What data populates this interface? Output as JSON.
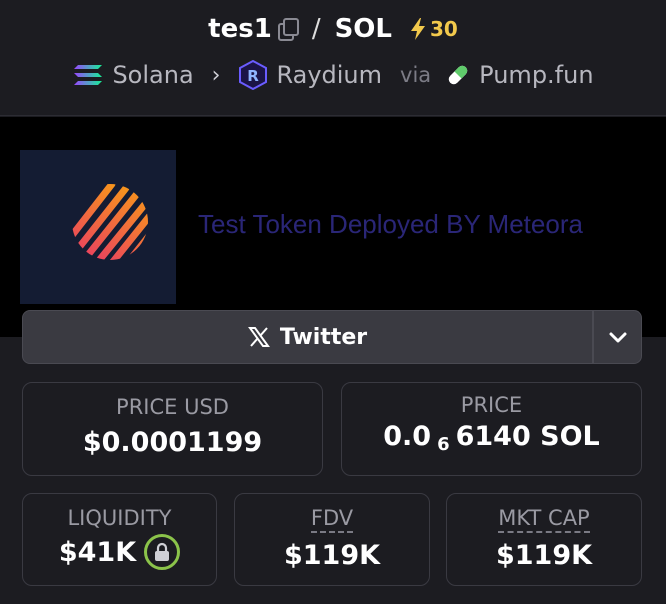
{
  "header": {
    "token_symbol": "tes1",
    "separator": "/",
    "quote_symbol": "SOL",
    "boost_count": "30",
    "chain": "Solana",
    "dex": "Raydium",
    "via": "via",
    "launchpad": "Pump.fun"
  },
  "banner": {
    "description": "Test Token Deployed BY Meteora"
  },
  "social": {
    "twitter_label": "Twitter"
  },
  "stats": {
    "price_usd_label": "PRICE USD",
    "price_usd_value": "$0.0001199",
    "price_label": "PRICE",
    "price_value_prefix": "0.0",
    "price_value_zeros": "6",
    "price_value_suffix": "6140 SOL",
    "liquidity_label": "LIQUIDITY",
    "liquidity_value": "$41K",
    "fdv_label": "FDV",
    "fdv_value": "$119K",
    "mktcap_label": "MKT CAP",
    "mktcap_value": "$119K"
  },
  "colors": {
    "background": "#1c1c21",
    "boost": "#f2c94c",
    "lock_ring": "#8bc34a",
    "description_text": "#2a2677"
  },
  "icons": [
    "copy-icon",
    "lightning-icon",
    "solana-logo",
    "chevron-right-icon",
    "raydium-logo",
    "pill-icon",
    "x-logo-icon",
    "chevron-down-icon",
    "lock-icon"
  ]
}
